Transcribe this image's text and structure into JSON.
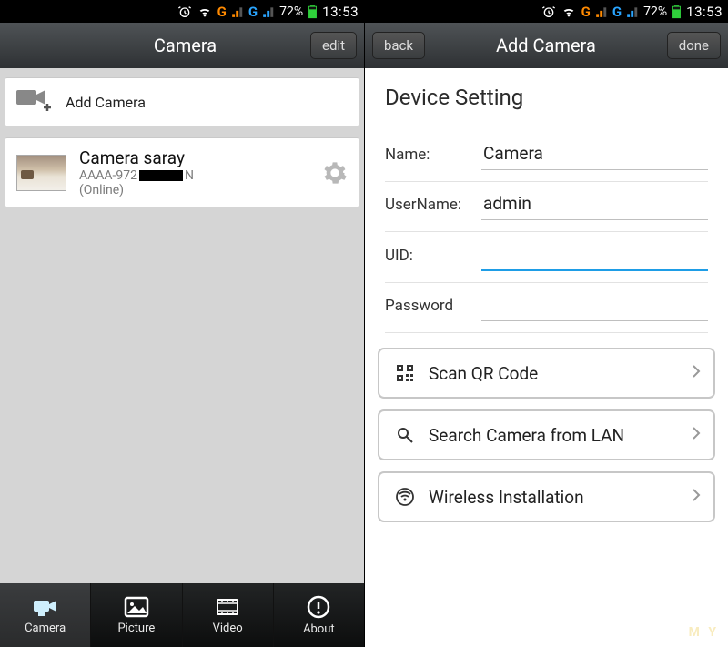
{
  "status": {
    "battery_pct": "72%",
    "time": "13:53",
    "net1": "G",
    "net2": "G"
  },
  "left": {
    "title": "Camera",
    "edit": "edit",
    "addCamera": "Add Camera",
    "camera": {
      "name": "Camera saray",
      "uid_prefix": "AAAA-972",
      "uid_suffix": "N",
      "status": "(Online)"
    },
    "tabs": [
      {
        "label": "Camera"
      },
      {
        "label": "Picture"
      },
      {
        "label": "Video"
      },
      {
        "label": "About"
      }
    ]
  },
  "right": {
    "back": "back",
    "title": "Add Camera",
    "done": "done",
    "section": "Device Setting",
    "fields": {
      "name_label": "Name:",
      "name_value": "Camera",
      "user_label": "UserName:",
      "user_value": "admin",
      "uid_label": "UID:",
      "uid_value": "",
      "pwd_label": "Password",
      "pwd_value": ""
    },
    "actions": [
      {
        "label": "Scan QR Code"
      },
      {
        "label": "Search Camera from LAN"
      },
      {
        "label": "Wireless Installation"
      }
    ],
    "watermark": "M Y"
  }
}
